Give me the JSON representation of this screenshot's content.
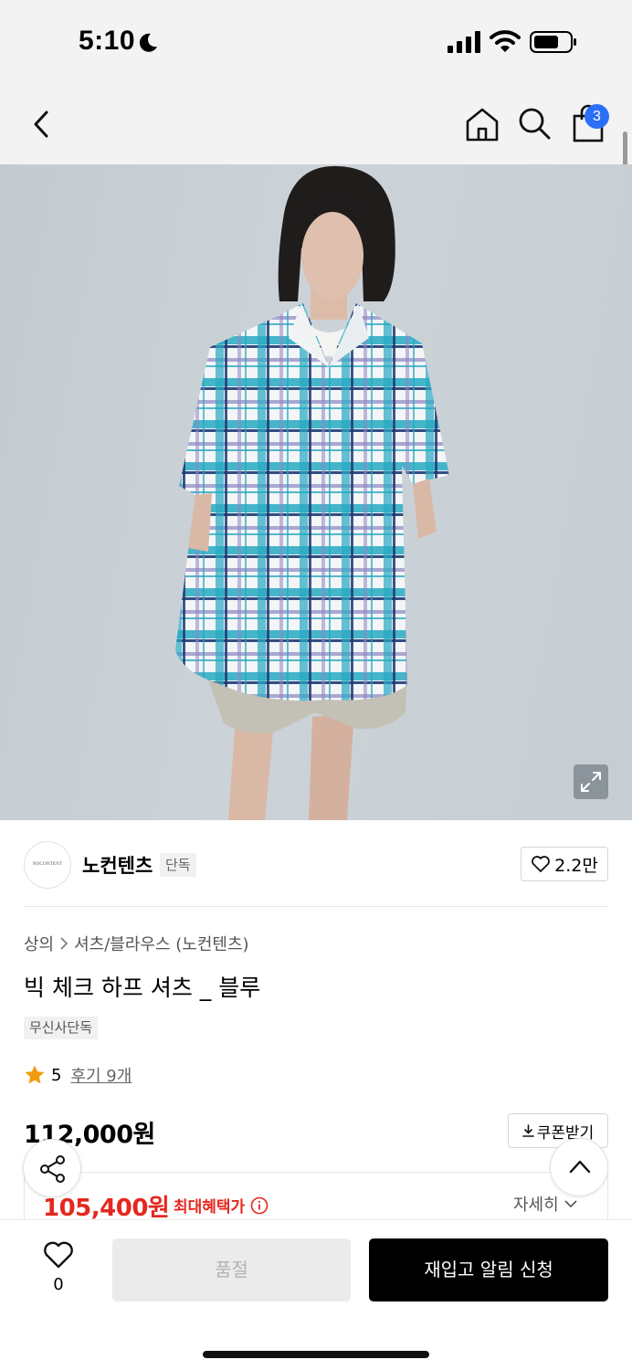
{
  "status_bar": {
    "time": "5:10",
    "icons": [
      "moon-icon",
      "signal-icon",
      "wifi-icon",
      "battery-icon"
    ]
  },
  "nav": {
    "icons": [
      "back-icon",
      "home-icon",
      "search-icon",
      "shopping-bag-icon"
    ],
    "cart_count": "3",
    "badge_color": "#2b6ff6"
  },
  "product_image": {
    "icons": [
      "expand-icon"
    ]
  },
  "brand": {
    "logo_text": "NOCONTENT",
    "name": "노컨텐츠",
    "exclusive_tag": "단독",
    "likes": "2.2만"
  },
  "product": {
    "breadcrumb": [
      "상의",
      "셔츠/블라우스 (노컨텐츠)"
    ],
    "title": "빅 체크 하프 셔츠 _ 블루",
    "tag": "무신사단독",
    "rating": "5",
    "reviews": "후기 9개",
    "price": "112,000원",
    "coupon_label": "쿠폰받기",
    "sale_price": "105,400원",
    "max_benefit_label": "최대혜택가",
    "details_label": "자세히"
  },
  "bottom_bar": {
    "wish_count": "0",
    "soldout_label": "품절",
    "restock_label": "재입고 알림 신청"
  },
  "colors": {
    "sale_red": "#e5281f",
    "star": "#f29a0e",
    "primary_button": "#000000"
  }
}
